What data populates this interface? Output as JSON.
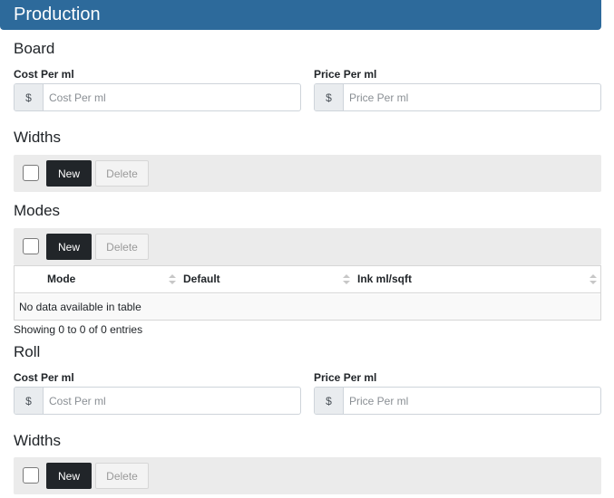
{
  "header": {
    "title": "Production"
  },
  "board": {
    "title": "Board",
    "cost": {
      "label": "Cost Per ml",
      "addon": "$",
      "placeholder": "Cost Per ml",
      "value": ""
    },
    "price": {
      "label": "Price Per ml",
      "addon": "$",
      "placeholder": "Price Per ml",
      "value": ""
    },
    "widths": {
      "title": "Widths",
      "new_label": "New",
      "delete_label": "Delete"
    },
    "modes": {
      "title": "Modes",
      "new_label": "New",
      "delete_label": "Delete",
      "columns": [
        "Mode",
        "Default",
        "Ink ml/sqft"
      ],
      "empty_text": "No data available in table",
      "info": "Showing 0 to 0 of 0 entries"
    }
  },
  "roll": {
    "title": "Roll",
    "cost": {
      "label": "Cost Per ml",
      "addon": "$",
      "placeholder": "Cost Per ml",
      "value": ""
    },
    "price": {
      "label": "Price Per ml",
      "addon": "$",
      "placeholder": "Price Per ml",
      "value": ""
    },
    "widths": {
      "title": "Widths",
      "new_label": "New",
      "delete_label": "Delete"
    }
  },
  "colors": {
    "header_bg": "#2d6a9b",
    "button_dark": "#212529",
    "toolbar_bg": "#ebebeb"
  }
}
